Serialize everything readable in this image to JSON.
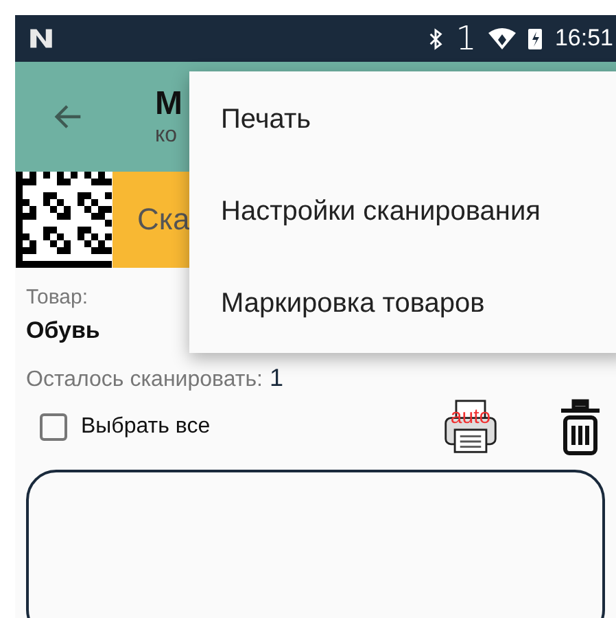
{
  "status_bar": {
    "sim": "1",
    "time": "16:51"
  },
  "app_bar": {
    "title": "М",
    "subtitle": "ко"
  },
  "scan_button": {
    "label": "Ска"
  },
  "product": {
    "label": "Товар:",
    "value": "Обувь"
  },
  "remaining": {
    "label": "Осталось сканировать:",
    "value": "1"
  },
  "select_all": {
    "label": "Выбрать все",
    "checked": false
  },
  "auto_print": {
    "badge": "auto"
  },
  "menu": {
    "items": [
      {
        "label": "Печать"
      },
      {
        "label": "Настройки сканирования"
      },
      {
        "label": "Маркировка товаров"
      }
    ]
  }
}
